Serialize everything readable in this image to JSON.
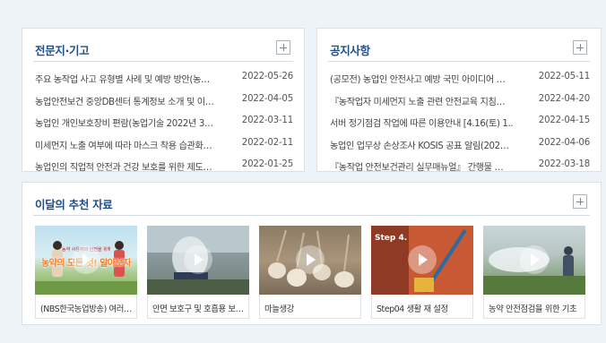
{
  "expert_column": {
    "title": "전문지·기고",
    "more_label": "+",
    "items": [
      {
        "title": "주요 농작업 사고 유형별 사례 및 예방 방안(농…",
        "date": "2022-05-26"
      },
      {
        "title": "농업안전보건 중앙DB센터 통계정보 소개 및 이…",
        "date": "2022-04-05"
      },
      {
        "title": "농업인 개인보호장비 편람(농업기술 2022년 3…",
        "date": "2022-03-11"
      },
      {
        "title": "미세먼지 노출 여부에 따라 마스크 착용 습관화…",
        "date": "2022-02-11"
      },
      {
        "title": "농업인의 직업적 안전과 건강 보호를 위한 제도…",
        "date": "2022-01-25"
      }
    ]
  },
  "notice": {
    "title": "공지사항",
    "more_label": "+",
    "items": [
      {
        "title": "(공모전) 농업인 안전사고 예방 국민 아이디어 …",
        "date": "2022-05-11"
      },
      {
        "title": "『농작업자 미세먼지 노출 관련 안전교육 지침…",
        "date": "2022-04-20"
      },
      {
        "title": "서버 정기점검 작업에 따른 이용안내 [4.16(토) 1..",
        "date": "2022-04-15"
      },
      {
        "title": "농업인 업무상 손상조사 KOSIS 공표 알림(202…",
        "date": "2022-04-06"
      },
      {
        "title": "『농작업 안전보건관리 실무매뉴얼』 간행물 …",
        "date": "2022-03-18"
      }
    ]
  },
  "recommend": {
    "title": "이달의 추천 자료",
    "more_label": "+",
    "cards": [
      {
        "caption": "(NBS한국농업방송) 여러…",
        "overlay": "농약의 모든 것! 알아보자",
        "overlay_sub": "농약 사용자의 안전을 위해",
        "icon": "video-thumbnail-people"
      },
      {
        "caption": "안면 보호구 및 호흡용 보…",
        "overlay": "",
        "overlay_sub": "",
        "icon": "video-thumbnail-face-shield"
      },
      {
        "caption": "마늘생강",
        "overlay": "",
        "overlay_sub": "",
        "icon": "video-thumbnail-garlic"
      },
      {
        "caption": "Step04 생활 재 설정",
        "overlay": "Step 4.",
        "overlay_sub": "",
        "icon": "video-thumbnail-step4"
      },
      {
        "caption": "농약 안전점검을 위한 기초",
        "overlay": "",
        "overlay_sub": "",
        "icon": "video-thumbnail-spraying"
      }
    ]
  },
  "colors": {
    "background": "#edf3f6",
    "title_blue": "#1f4f86",
    "border": "#d9e1e5"
  }
}
